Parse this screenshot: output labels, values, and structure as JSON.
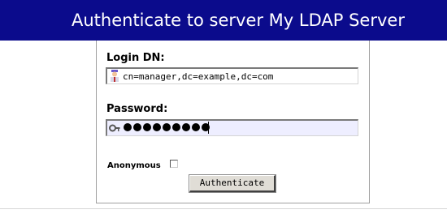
{
  "header": {
    "title": "Authenticate to server My LDAP Server"
  },
  "form": {
    "login_dn_label": "Login DN:",
    "login_dn_value": "cn=manager,dc=example,dc=com",
    "login_icon": "user-icon",
    "password_label": "Password:",
    "password_icon": "key-icon",
    "password_mask_count": 9,
    "anonymous_label": "Anonymous",
    "anonymous_checked": false,
    "submit_label": "Authenticate"
  },
  "colors": {
    "header_bg": "#0b0b8c",
    "header_text": "#ffffff",
    "password_field_bg": "#eeeeff",
    "button_bg": "#e0ddd6"
  }
}
